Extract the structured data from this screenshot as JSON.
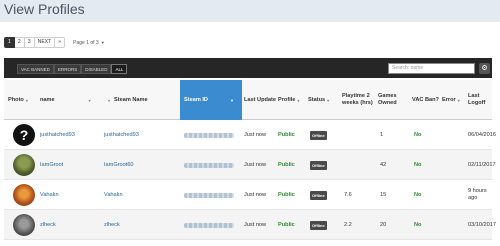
{
  "page": {
    "title": "View Profiles"
  },
  "pagination": {
    "pages": [
      "1",
      "2",
      "3",
      "NEXT",
      "»"
    ],
    "active": "1",
    "page_of": "Page 1 of 3"
  },
  "toolbar": {
    "filters": [
      "VAC BANNED",
      "ERRORS",
      "DISABLED",
      "ALL"
    ],
    "active_filter": "ALL",
    "search_placeholder": "Search: name"
  },
  "table": {
    "columns": [
      "Photo",
      "name",
      "Steam Name",
      "Steam ID",
      "Last Update",
      "Profile",
      "Status",
      "Playtime 2 weeks (hrs)",
      "Games Owned",
      "VAC Ban?",
      "Error",
      "Last Logoff"
    ],
    "sorted_column": "Steam ID",
    "rows": [
      {
        "avatar": "question-mark-avatar",
        "name": "justhatched93",
        "steam_name": "justhatched93",
        "last_update": "Just now",
        "profile": "Public",
        "status": "Offline",
        "playtime": "",
        "games": "1",
        "vac": "No",
        "error": "",
        "last_logoff": "06/04/2016"
      },
      {
        "avatar": "groot-avatar",
        "name": "IamGroot",
        "steam_name": "IamGroot60",
        "last_update": "Just now",
        "profile": "Public",
        "status": "Offline",
        "playtime": "",
        "games": "42",
        "vac": "No",
        "error": "",
        "last_logoff": "02/11/2017"
      },
      {
        "avatar": "vahakn-avatar",
        "name": "Vahakn",
        "steam_name": "Vahakn",
        "last_update": "Just now",
        "profile": "Public",
        "status": "Offline",
        "playtime": "7.6",
        "games": "15",
        "vac": "No",
        "error": "",
        "last_logoff": "9 hours ago"
      },
      {
        "avatar": "zlheck-avatar",
        "name": "zlheck",
        "steam_name": "zlheck",
        "last_update": "Just now",
        "profile": "Public",
        "status": "Offline",
        "playtime": "2.2",
        "games": "20",
        "vac": "No",
        "error": "",
        "last_logoff": "03/10/2017"
      }
    ]
  },
  "colors": {
    "accent": "#3b8bd0",
    "public": "#2e8b2e",
    "toolbar": "#262626"
  }
}
